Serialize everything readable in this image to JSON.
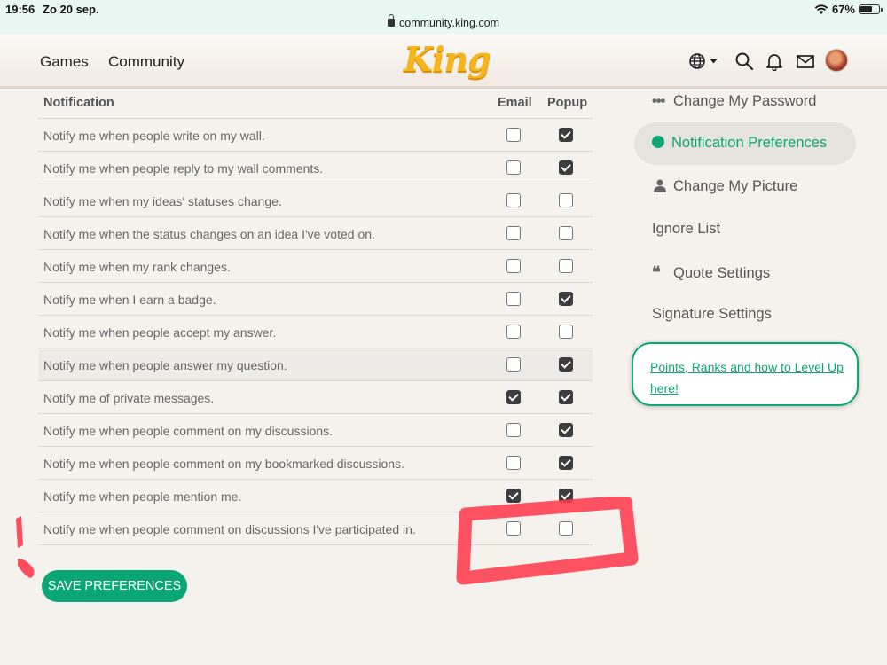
{
  "status_bar": {
    "time": "19:56",
    "date": "Zo 20 sep.",
    "url": "community.king.com",
    "battery": "67%"
  },
  "header": {
    "nav": [
      "Games",
      "Community"
    ],
    "logo": "King",
    "icons": [
      "globe-icon",
      "search-icon",
      "bell-icon",
      "mail-icon",
      "avatar"
    ]
  },
  "table": {
    "col_notification": "Notification",
    "col_email": "Email",
    "col_popup": "Popup",
    "rows": [
      {
        "label": "Notify me when people write on my wall.",
        "email": false,
        "popup": true
      },
      {
        "label": "Notify me when people reply to my wall comments.",
        "email": false,
        "popup": true
      },
      {
        "label": "Notify me when my ideas' statuses change.",
        "email": false,
        "popup": false
      },
      {
        "label": "Notify me when the status changes on an idea I've voted on.",
        "email": false,
        "popup": false
      },
      {
        "label": "Notify me when my rank changes.",
        "email": false,
        "popup": false
      },
      {
        "label": "Notify me when I earn a badge.",
        "email": false,
        "popup": true
      },
      {
        "label": "Notify me when people accept my answer.",
        "email": false,
        "popup": false
      },
      {
        "label": "Notify me when people answer my question.",
        "email": false,
        "popup": true
      },
      {
        "label": "Notify me of private messages.",
        "email": true,
        "popup": true
      },
      {
        "label": "Notify me when people comment on my discussions.",
        "email": false,
        "popup": true
      },
      {
        "label": "Notify me when people comment on my bookmarked discussions.",
        "email": false,
        "popup": true
      },
      {
        "label": "Notify me when people mention me.",
        "email": true,
        "popup": true
      },
      {
        "label": "Notify me when people comment on discussions I've participated in.",
        "email": false,
        "popup": false
      }
    ]
  },
  "save_button": "SAVE PREFERENCES",
  "sidebar": {
    "change_password": "Change My Password",
    "notification_preferences": "Notification Preferences",
    "change_picture": "Change My Picture",
    "ignore_list": "Ignore List",
    "quote_settings": "Quote Settings",
    "signature_settings": "Signature Settings",
    "points_link": "Points, Ranks and how to Level Up here!"
  },
  "colors": {
    "accent": "#0aa775",
    "annotation": "#ff3b4e"
  }
}
